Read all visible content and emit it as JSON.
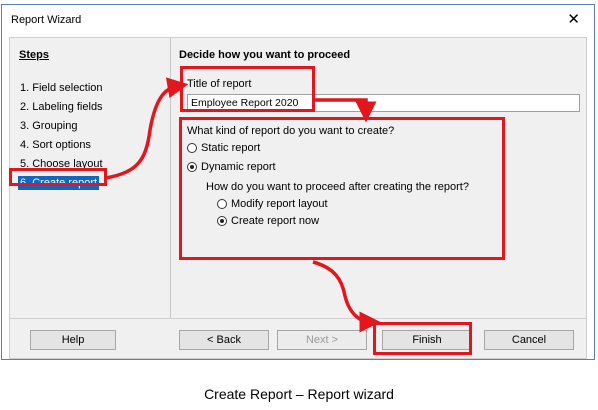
{
  "window": {
    "title": "Report Wizard",
    "close_glyph": "✕"
  },
  "steps": {
    "heading": "Steps",
    "items": [
      {
        "label": "1. Field selection"
      },
      {
        "label": "2. Labeling fields"
      },
      {
        "label": "3. Grouping"
      },
      {
        "label": "4. Sort options"
      },
      {
        "label": "5. Choose layout"
      },
      {
        "label": "6. Create report",
        "active": true
      }
    ]
  },
  "main": {
    "heading": "Decide how you want to proceed",
    "title_label": "Title of report",
    "title_value": "Employee Report 2020",
    "kind_question": "What kind of report do you want to create?",
    "static_label": "Static report",
    "dynamic_label": "Dynamic report",
    "proceed_question": "How do you want to proceed after creating the report?",
    "modify_label": "Modify report layout",
    "create_now_label": "Create report now",
    "selected_kind": "Dynamic report",
    "selected_proceed": "Create report now"
  },
  "buttons": {
    "help": "Help",
    "back": "< Back",
    "next": "Next >",
    "finish": "Finish",
    "cancel": "Cancel"
  },
  "annotation_color": "#e2161c",
  "caption": "Create Report – Report wizard"
}
